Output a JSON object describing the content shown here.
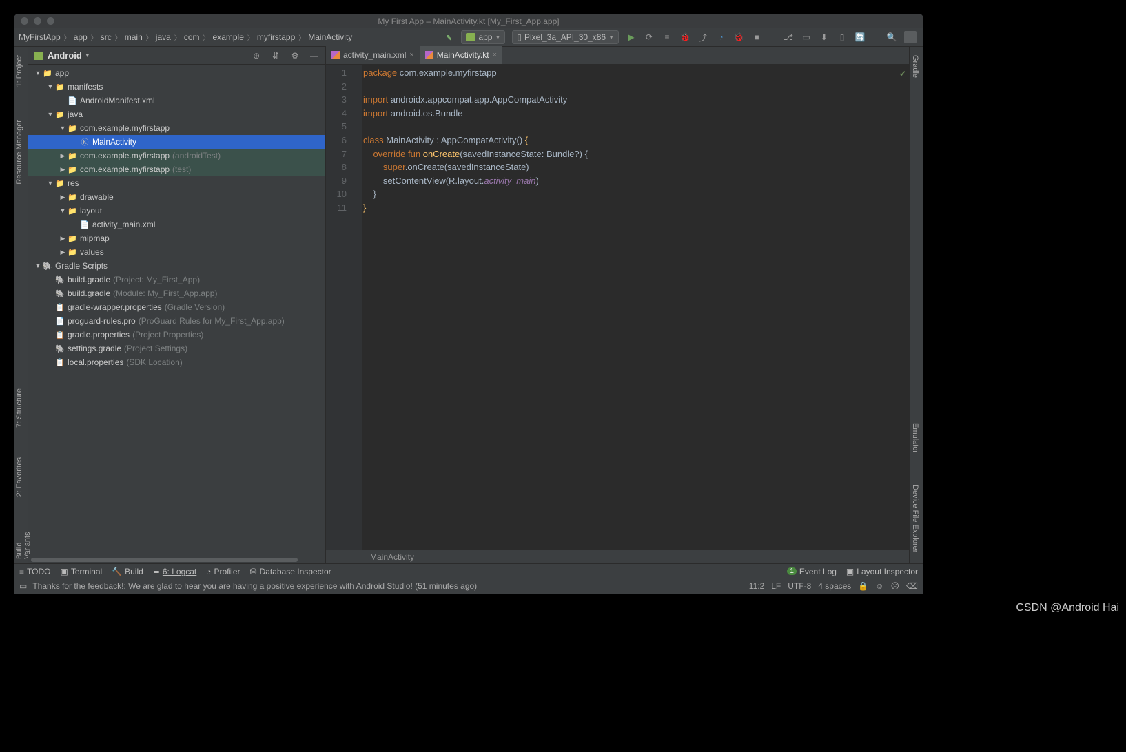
{
  "window": {
    "title": "My First App – MainActivity.kt [My_First_App.app]"
  },
  "breadcrumb": [
    "MyFirstApp",
    "app",
    "src",
    "main",
    "java",
    "com",
    "example",
    "myfirstapp",
    "MainActivity"
  ],
  "toolbar": {
    "run_config": "app",
    "device": "Pixel_3a_API_30_x86"
  },
  "panel": {
    "label": "Android",
    "tree": [
      {
        "d": 0,
        "a": "▼",
        "ic": "folder",
        "name": "app"
      },
      {
        "d": 1,
        "a": "▼",
        "ic": "folder",
        "name": "manifests"
      },
      {
        "d": 2,
        "a": "",
        "ic": "xml",
        "name": "AndroidManifest.xml"
      },
      {
        "d": 1,
        "a": "▼",
        "ic": "folder",
        "name": "java"
      },
      {
        "d": 2,
        "a": "▼",
        "ic": "folder",
        "name": "com.example.myfirstapp"
      },
      {
        "d": 3,
        "a": "",
        "ic": "kt",
        "name": "MainActivity",
        "sel": "blue"
      },
      {
        "d": 2,
        "a": "▶",
        "ic": "folder",
        "name": "com.example.myfirstapp",
        "hint": "(androidTest)",
        "sel": "green"
      },
      {
        "d": 2,
        "a": "▶",
        "ic": "folder",
        "name": "com.example.myfirstapp",
        "hint": "(test)",
        "sel": "green"
      },
      {
        "d": 1,
        "a": "▼",
        "ic": "folder",
        "name": "res"
      },
      {
        "d": 2,
        "a": "▶",
        "ic": "folder",
        "name": "drawable"
      },
      {
        "d": 2,
        "a": "▼",
        "ic": "folder",
        "name": "layout"
      },
      {
        "d": 3,
        "a": "",
        "ic": "xml",
        "name": "activity_main.xml"
      },
      {
        "d": 2,
        "a": "▶",
        "ic": "folder",
        "name": "mipmap"
      },
      {
        "d": 2,
        "a": "▶",
        "ic": "folder",
        "name": "values"
      },
      {
        "d": 0,
        "a": "▼",
        "ic": "gradle",
        "name": "Gradle Scripts"
      },
      {
        "d": 1,
        "a": "",
        "ic": "gradle",
        "name": "build.gradle",
        "hint": "(Project: My_First_App)"
      },
      {
        "d": 1,
        "a": "",
        "ic": "gradle",
        "name": "build.gradle",
        "hint": "(Module: My_First_App.app)"
      },
      {
        "d": 1,
        "a": "",
        "ic": "prop",
        "name": "gradle-wrapper.properties",
        "hint": "(Gradle Version)"
      },
      {
        "d": 1,
        "a": "",
        "ic": "txt",
        "name": "proguard-rules.pro",
        "hint": "(ProGuard Rules for My_First_App.app)"
      },
      {
        "d": 1,
        "a": "",
        "ic": "prop",
        "name": "gradle.properties",
        "hint": "(Project Properties)"
      },
      {
        "d": 1,
        "a": "",
        "ic": "gradle",
        "name": "settings.gradle",
        "hint": "(Project Settings)"
      },
      {
        "d": 1,
        "a": "",
        "ic": "prop",
        "name": "local.properties",
        "hint": "(SDK Location)"
      }
    ]
  },
  "tabs": [
    {
      "name": "activity_main.xml",
      "active": false
    },
    {
      "name": "MainActivity.kt",
      "active": true
    }
  ],
  "code": {
    "lines": [
      1,
      2,
      3,
      4,
      5,
      6,
      7,
      8,
      9,
      10,
      11
    ],
    "source": [
      {
        "t": "package ",
        "c": "kw"
      },
      {
        "t": "com.example.myfirstapp\n\n"
      },
      {
        "t": "import ",
        "c": "kw"
      },
      {
        "t": "androidx.appcompat.app.AppCompatActivity\n"
      },
      {
        "t": "import ",
        "c": "kw"
      },
      {
        "t": "android.os.Bundle\n\n"
      },
      {
        "t": "class ",
        "c": "kw"
      },
      {
        "t": "MainActivity : AppCompatActivity() "
      },
      {
        "t": "{",
        "c": "fn"
      },
      {
        "t": "\n"
      },
      {
        "t": "    override fun ",
        "c": "kw"
      },
      {
        "t": "onCreate",
        "c": "fn"
      },
      {
        "t": "(savedInstanceState: Bundle?) {\n"
      },
      {
        "t": "        super",
        "c": "kw"
      },
      {
        "t": ".onCreate(savedInstanceState)\n"
      },
      {
        "t": "        setContentView(R.layout."
      },
      {
        "t": "activity_main",
        "c": "it"
      },
      {
        "t": ")\n"
      },
      {
        "t": "    }\n"
      },
      {
        "t": "}",
        "c": "fn"
      }
    ],
    "breadcrumb": "MainActivity"
  },
  "left_tabs": [
    "1: Project",
    "Resource Manager",
    "7: Structure",
    "2: Favorites",
    "Build Variants"
  ],
  "right_tabs": [
    "Gradle",
    "Emulator",
    "Device File Explorer"
  ],
  "toolwindows": {
    "left": [
      "TODO",
      "Terminal",
      "Build",
      "6: Logcat",
      "Profiler",
      "Database Inspector"
    ],
    "right": [
      "Event Log",
      "Layout Inspector"
    ],
    "event_badge": "1"
  },
  "status": {
    "msg": "Thanks for the feedback!: We are glad to hear you are having a positive experience with Android Studio! (51 minutes ago)",
    "pos": "11:2",
    "lf": "LF",
    "enc": "UTF-8",
    "indent": "4 spaces"
  },
  "watermark": "CSDN @Android Hai"
}
